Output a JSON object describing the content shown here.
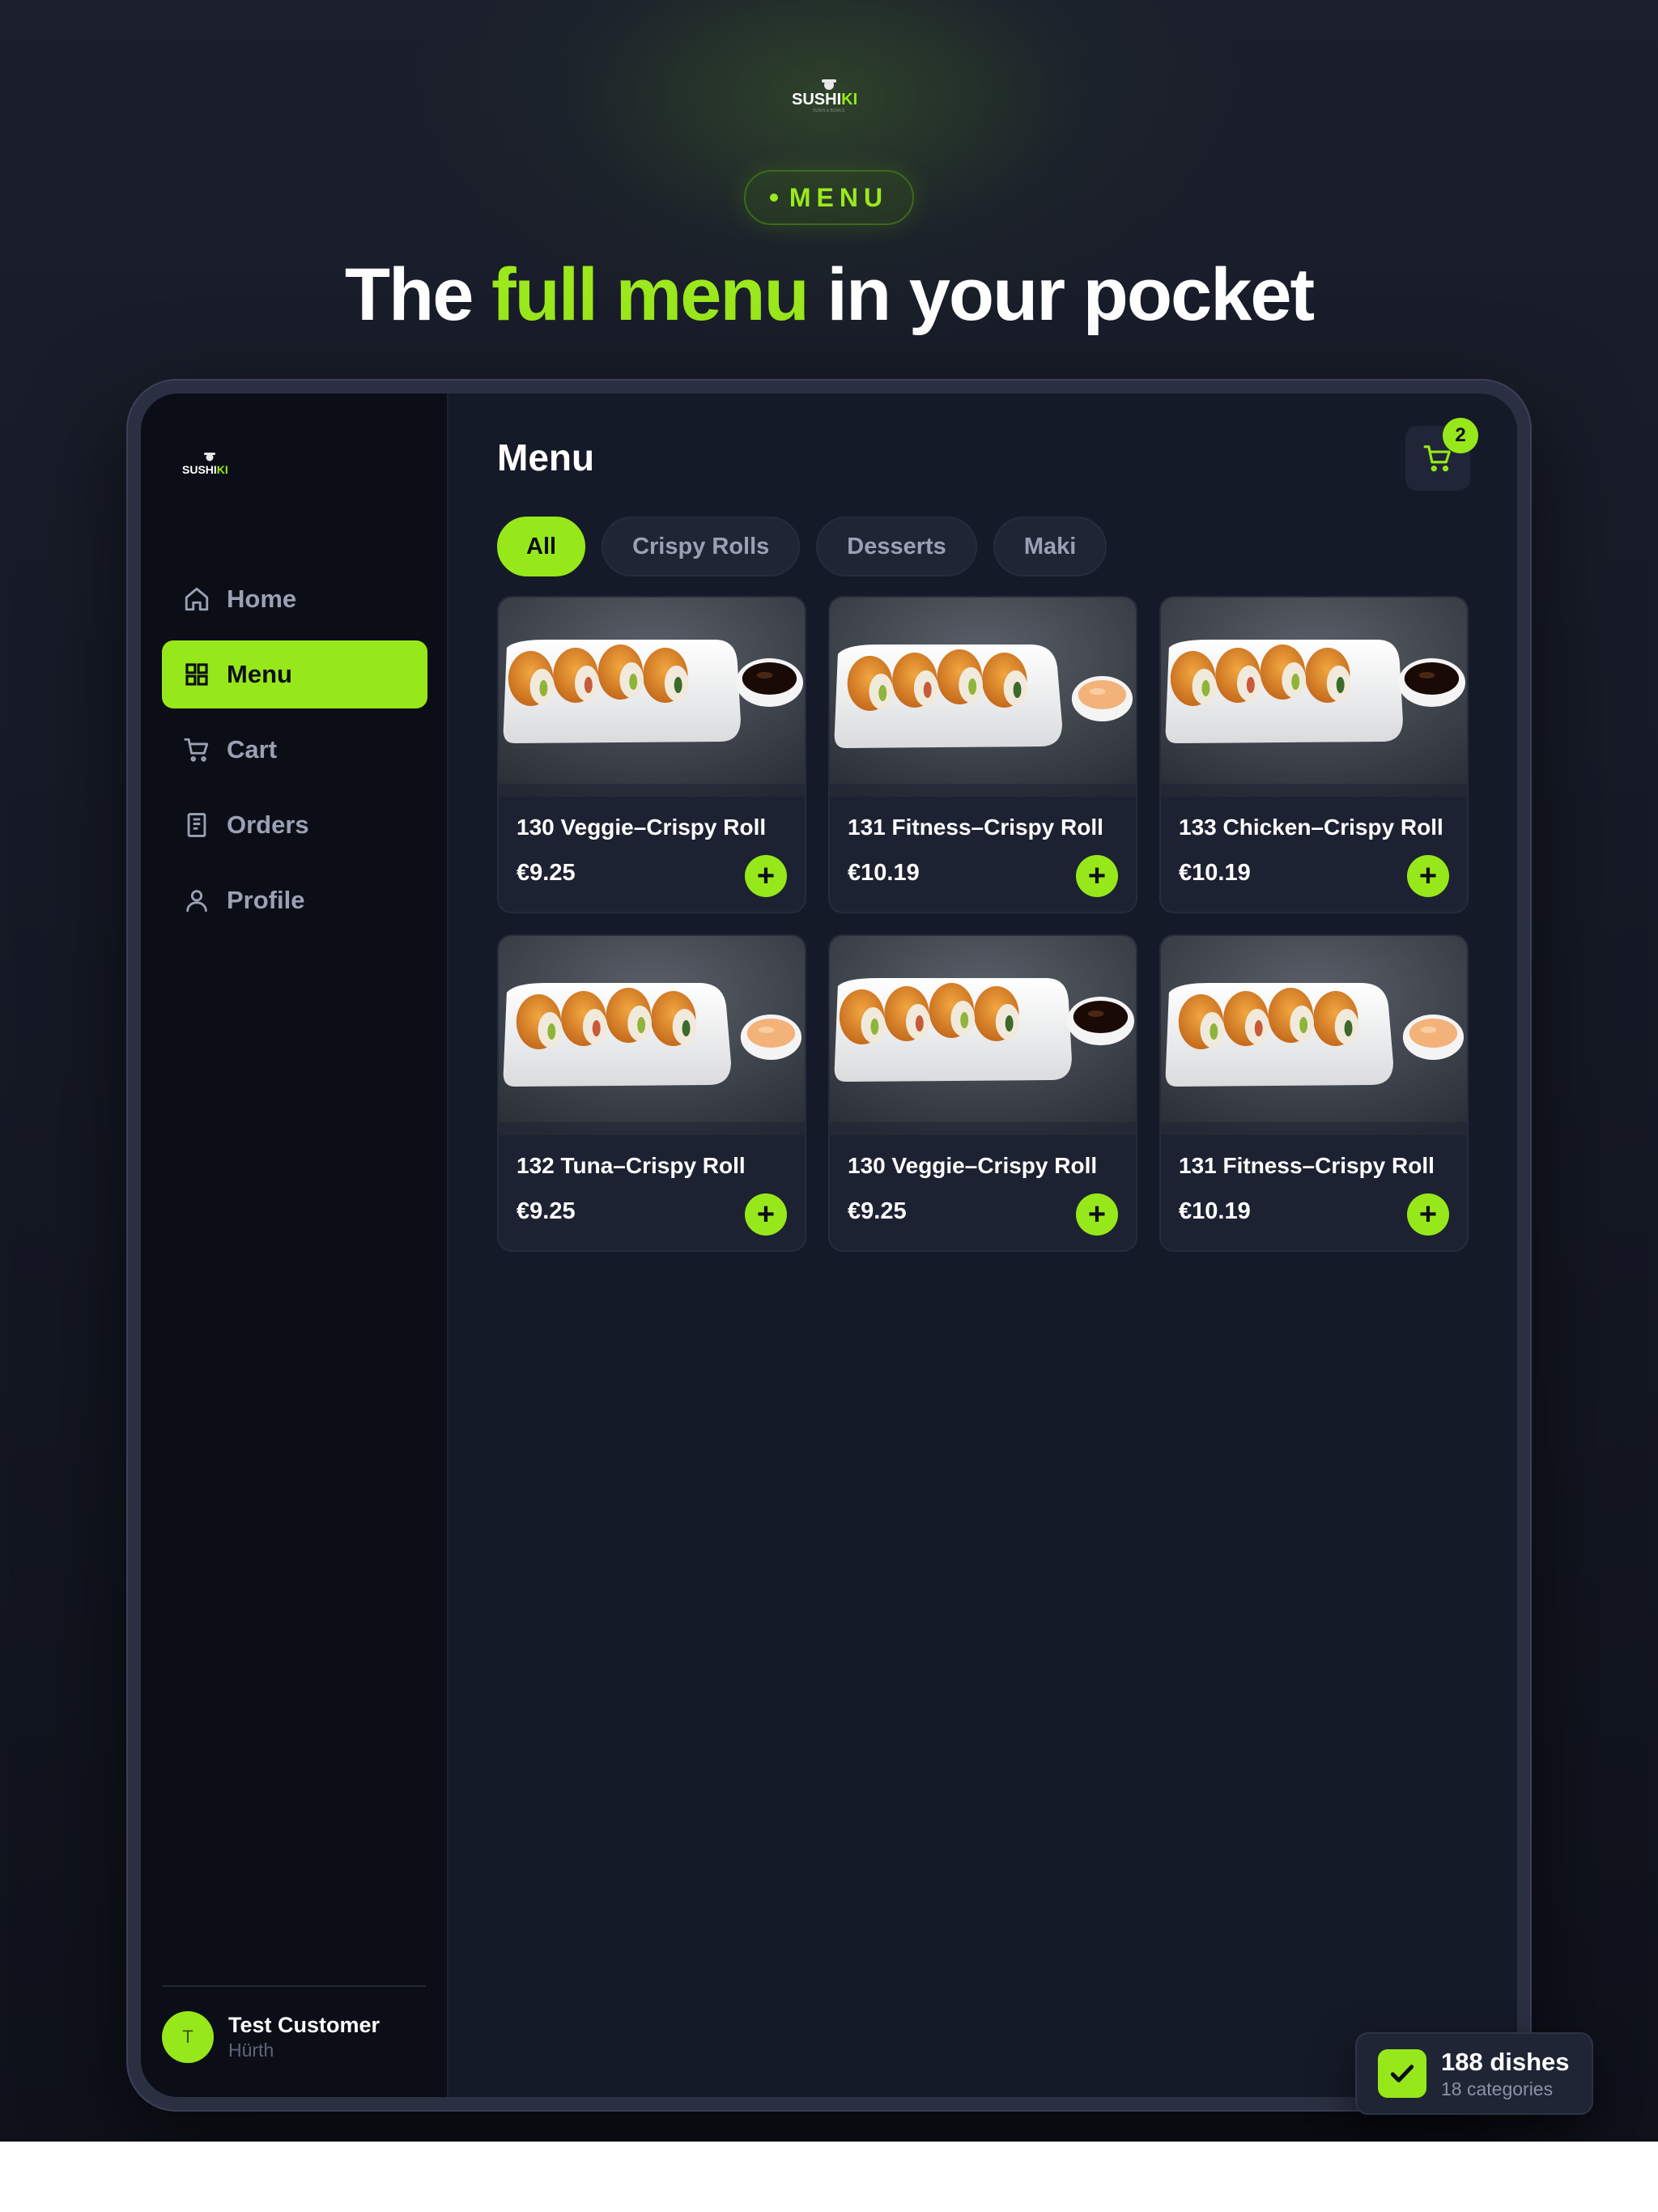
{
  "hero": {
    "brand": "SUSHIKI",
    "pill_label": "MENU",
    "headline_pre": "The ",
    "headline_accent": "full menu",
    "headline_post": " in your pocket"
  },
  "colors": {
    "accent": "#97e81a",
    "background": "#161a26",
    "card": "#1d2232"
  },
  "sidebar": {
    "brand": "SUSHIKI",
    "items": [
      {
        "label": "Home",
        "icon": "home-icon",
        "active": false
      },
      {
        "label": "Menu",
        "icon": "grid-icon",
        "active": true
      },
      {
        "label": "Cart",
        "icon": "cart-icon",
        "active": false
      },
      {
        "label": "Orders",
        "icon": "receipt-icon",
        "active": false
      },
      {
        "label": "Profile",
        "icon": "user-icon",
        "active": false
      }
    ],
    "user": {
      "initial": "T",
      "name": "Test Customer",
      "location": "Hürth"
    }
  },
  "main": {
    "title": "Menu",
    "cart_count": "2",
    "filters": [
      "All",
      "Crispy Rolls",
      "Desserts",
      "Maki"
    ],
    "active_filter": "All",
    "items": [
      {
        "name": "130 Veggie–Crispy Roll",
        "price": "€9.25"
      },
      {
        "name": "131 Fitness–Crispy Roll",
        "price": "€10.19"
      },
      {
        "name": "133 Chicken–Crispy Roll",
        "price": "€10.19"
      },
      {
        "name": "132 Tuna–Crispy Roll",
        "price": "€9.25"
      },
      {
        "name": "130 Veggie–Crispy Roll",
        "price": "€9.25"
      },
      {
        "name": "131 Fitness–Crispy Roll",
        "price": "€10.19"
      }
    ],
    "add_symbol": "+"
  },
  "toast": {
    "title": "188 dishes",
    "subtitle": "18 categories"
  }
}
